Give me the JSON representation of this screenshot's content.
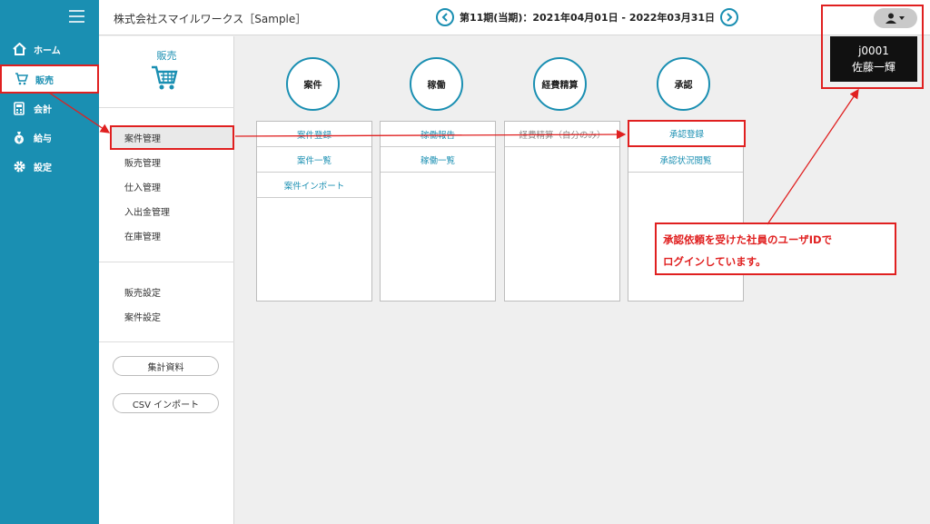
{
  "nav": {
    "items": [
      {
        "label": "ホーム",
        "icon": "home-icon"
      },
      {
        "label": "販売",
        "icon": "cart-icon"
      },
      {
        "label": "会計",
        "icon": "calculator-icon"
      },
      {
        "label": "給与",
        "icon": "money-bag-icon"
      },
      {
        "label": "設定",
        "icon": "gear-icon"
      }
    ]
  },
  "header": {
    "company": "株式会社スマイルワークス［Sample］",
    "period": "第11期(当期)：2021年04月01日 - 2022年03月31日"
  },
  "user": {
    "id": "j0001",
    "name": "佐藤一輝"
  },
  "sidebar": {
    "title": "販売",
    "group1": [
      "案件管理",
      "販売管理",
      "仕入管理",
      "入出金管理",
      "在庫管理"
    ],
    "group2": [
      "販売設定",
      "案件設定"
    ],
    "buttons": [
      "集計資料",
      "CSV インポート"
    ]
  },
  "sections": [
    {
      "title": "案件",
      "links": [
        "案件登録",
        "案件一覧",
        "案件インポート"
      ]
    },
    {
      "title": "稼働",
      "links": [
        "稼働報告",
        "稼働一覧"
      ]
    },
    {
      "title": "経費精算",
      "links": [
        "経費精算（自分のみ）"
      ]
    },
    {
      "title": "承認",
      "links": [
        "承認登録",
        "承認状況閲覧"
      ]
    }
  ],
  "annotation": {
    "line1": "承認依頼を受けた社員のユーザIDで",
    "line2": "ログインしています。"
  },
  "colors": {
    "accent": "#1a8fb2",
    "highlight": "#e02020"
  }
}
